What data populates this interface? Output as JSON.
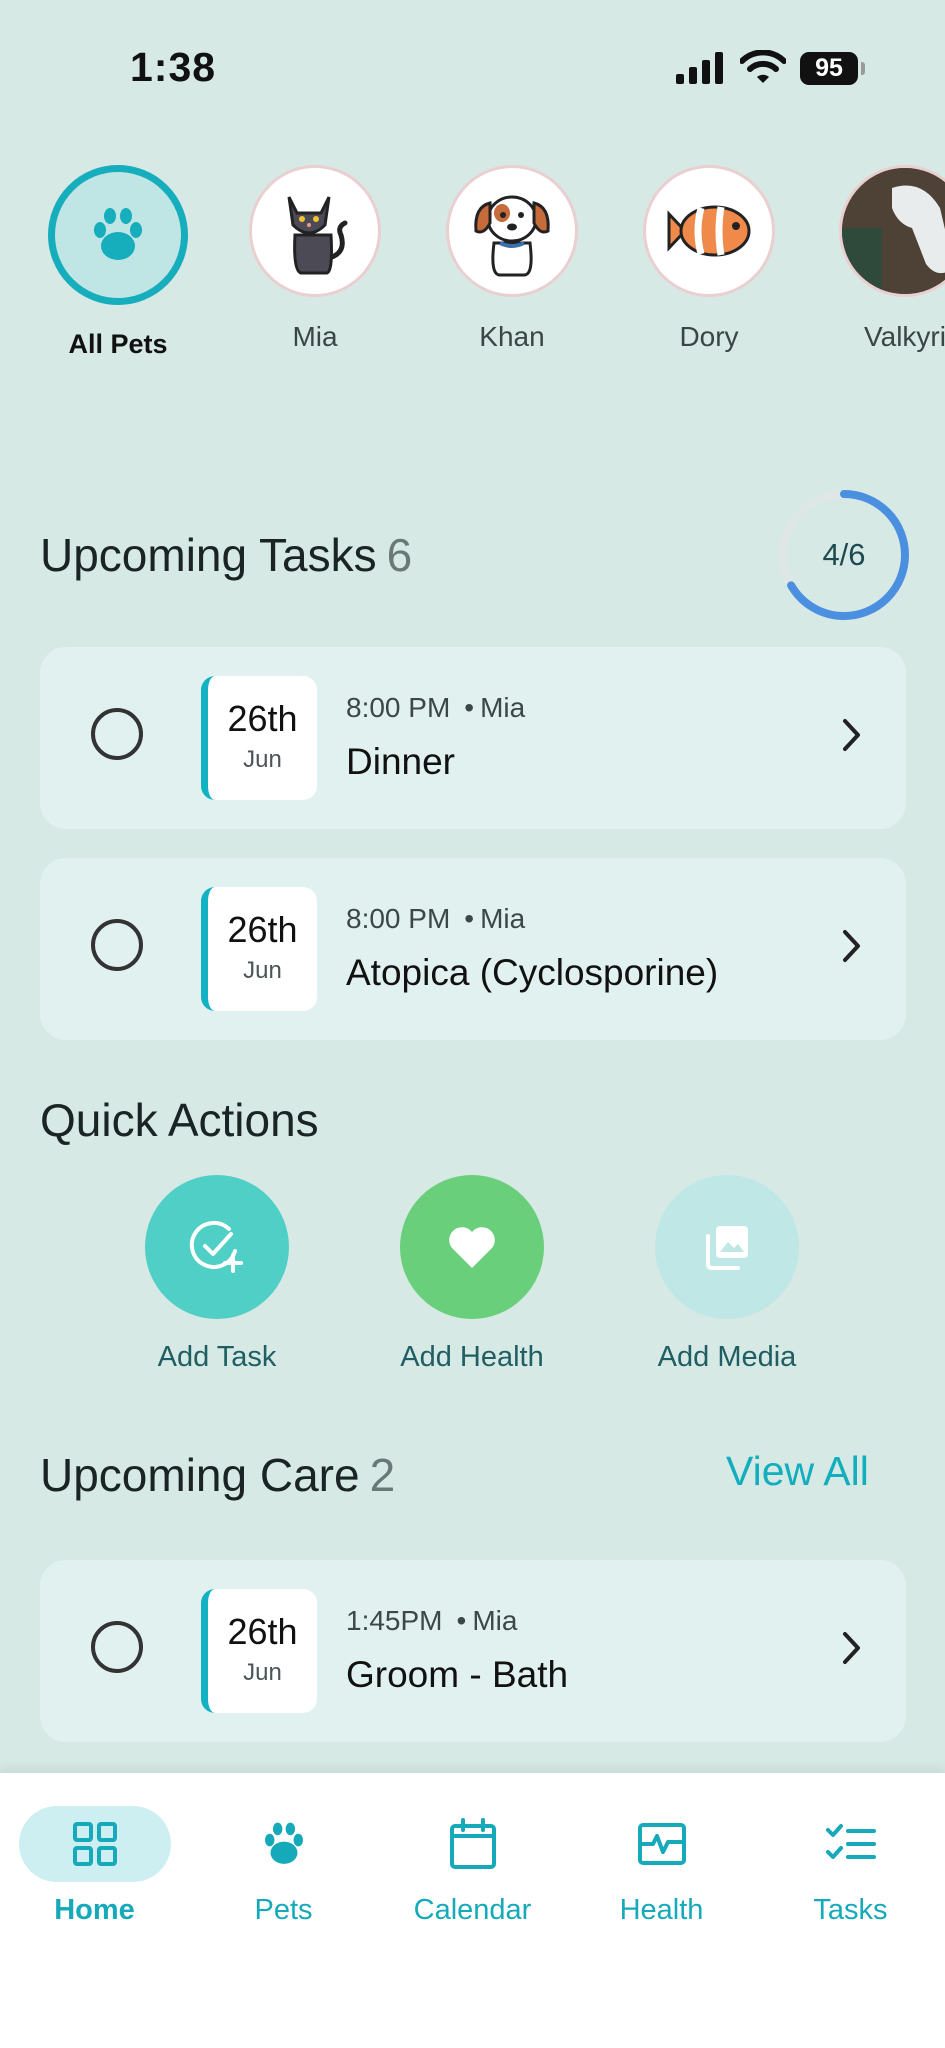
{
  "status": {
    "time": "1:38",
    "battery": "95"
  },
  "pets": [
    {
      "label": "All Pets",
      "icon": "paw-icon"
    },
    {
      "label": "Mia",
      "icon": "cat-icon"
    },
    {
      "label": "Khan",
      "icon": "dog-icon"
    },
    {
      "label": "Dory",
      "icon": "clownfish-icon"
    },
    {
      "label": "Valkyri",
      "icon": "horse-photo"
    }
  ],
  "upcoming_tasks": {
    "title": "Upcoming Tasks",
    "count": "6",
    "progress": "4/6",
    "progress_fraction": 0.6667,
    "items": [
      {
        "day": "26th",
        "month": "Jun",
        "time": "8:00 PM",
        "pet": "Mia",
        "title": "Dinner"
      },
      {
        "day": "26th",
        "month": "Jun",
        "time": "8:00 PM",
        "pet": "Mia",
        "title": "Atopica (Cyclosporine)"
      }
    ]
  },
  "quick_actions": {
    "title": "Quick Actions",
    "items": [
      {
        "label": "Add Task",
        "icon": "check-plus-icon",
        "color": "#4fcfc5"
      },
      {
        "label": "Add Health",
        "icon": "heart-icon",
        "color": "#69cf7b"
      },
      {
        "label": "Add Media",
        "icon": "gallery-icon",
        "color": "#bfe7e5"
      }
    ]
  },
  "upcoming_care": {
    "title": "Upcoming Care",
    "count": "2",
    "view_all": "View All",
    "items": [
      {
        "day": "26th",
        "month": "Jun",
        "time": "1:45PM",
        "pet": "Mia",
        "title": "Groom - Bath"
      }
    ]
  },
  "nav": [
    {
      "label": "Home",
      "icon": "grid-icon",
      "active": true
    },
    {
      "label": "Pets",
      "icon": "paw-icon"
    },
    {
      "label": "Calendar",
      "icon": "calendar-icon"
    },
    {
      "label": "Health",
      "icon": "health-monitor-icon"
    },
    {
      "label": "Tasks",
      "icon": "checklist-icon"
    }
  ],
  "colors": {
    "accent": "#12aebd",
    "background": "#d6e9e5",
    "progress": "#4a8fe0"
  }
}
